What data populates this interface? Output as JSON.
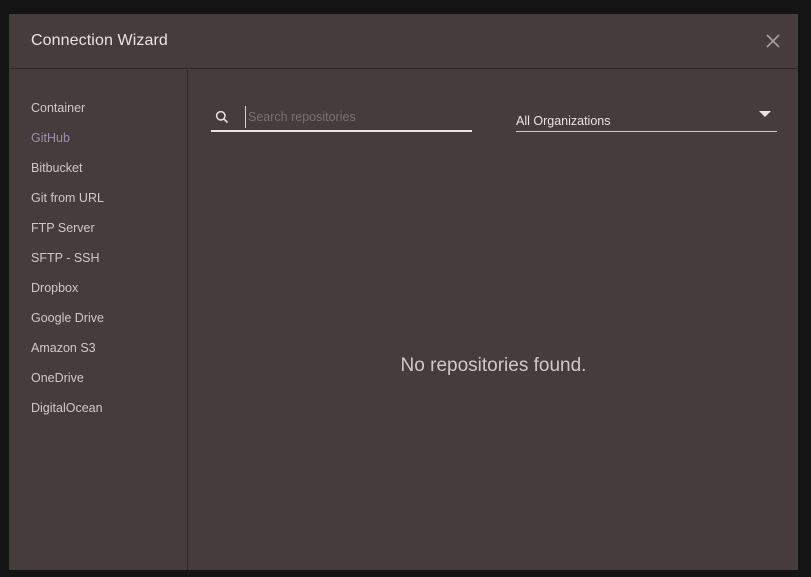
{
  "dialog": {
    "title": "Connection Wizard",
    "close_icon": "close-icon"
  },
  "sidebar": {
    "active_index": 1,
    "items": [
      {
        "label": "Container"
      },
      {
        "label": "GitHub"
      },
      {
        "label": "Bitbucket"
      },
      {
        "label": "Git from URL"
      },
      {
        "label": "FTP Server"
      },
      {
        "label": "SFTP - SSH"
      },
      {
        "label": "Dropbox"
      },
      {
        "label": "Google Drive"
      },
      {
        "label": "Amazon S3"
      },
      {
        "label": "OneDrive"
      },
      {
        "label": "DigitalOcean"
      }
    ]
  },
  "main": {
    "search": {
      "placeholder": "Search repositories",
      "value": "",
      "icon": "search-icon"
    },
    "org_select": {
      "selected": "All Organizations",
      "icon": "caret-down-icon"
    },
    "empty_message": "No repositories found."
  },
  "colors": {
    "dialog_bg": "#463c3c",
    "backdrop": "#141414",
    "active_item": "#9d90b0",
    "text": "#e8e4e4"
  }
}
